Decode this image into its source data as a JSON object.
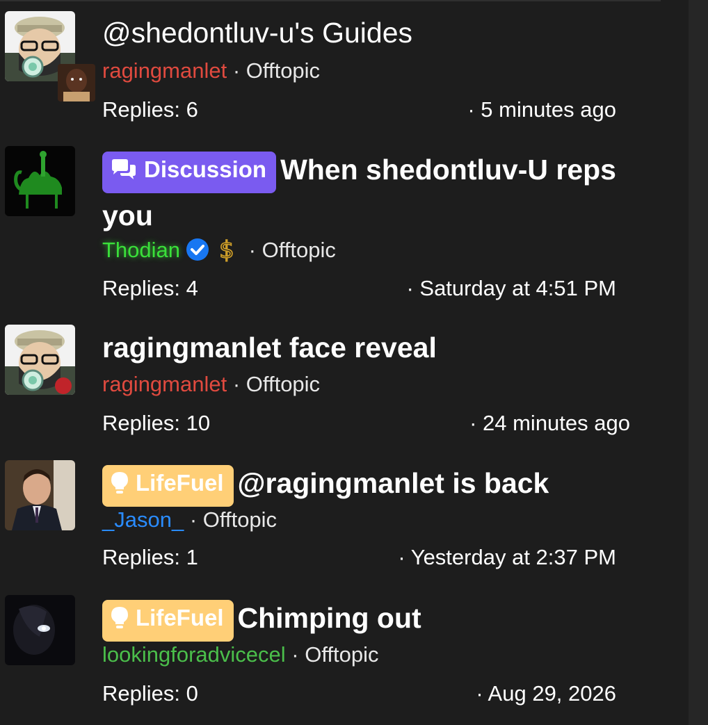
{
  "threads": [
    {
      "title": "@shedontluv-u's Guides",
      "author": "ragingmanlet",
      "forum": "Offtopic",
      "replies": "Replies: 6",
      "time": "· 5 minutes ago"
    },
    {
      "label": "Discussion",
      "title": "When shedontluv-U reps you",
      "author": "Thodian",
      "forum": "Offtopic",
      "replies": "Replies: 4",
      "time": "· Saturday at 4:51 PM"
    },
    {
      "title": "ragingmanlet face reveal",
      "author": "ragingmanlet",
      "forum": "Offtopic",
      "replies": "Replies: 10",
      "time": "· 24 minutes ago"
    },
    {
      "label": "LifeFuel",
      "title": "@ragingmanlet is back",
      "author": "_Jason_",
      "forum": "Offtopic",
      "replies": "Replies: 1",
      "time": "· Yesterday at 2:37 PM"
    },
    {
      "label": "LifeFuel",
      "title": "Chimping out",
      "author": "lookingforadvicecel",
      "forum": "Offtopic",
      "replies": "Replies: 0",
      "time": "· Aug 29, 2026"
    }
  ],
  "separator": "·",
  "icons": {
    "discussion_label": "chat-bubbles-icon",
    "lifefuel_label": "lightbulb-icon",
    "verified": "verified-check-icon",
    "badge": "dollar-badge-icon"
  },
  "colors": {
    "background": "#1d1d1d",
    "discussion_label": "#7a5bf0",
    "lifefuel_label": "#ffcf77",
    "username_red": "#e04a3f",
    "username_glow_green": "#3ae03a",
    "username_blue": "#2a8cff",
    "username_green": "#4bbf4b",
    "verified_blue": "#1877f2"
  }
}
